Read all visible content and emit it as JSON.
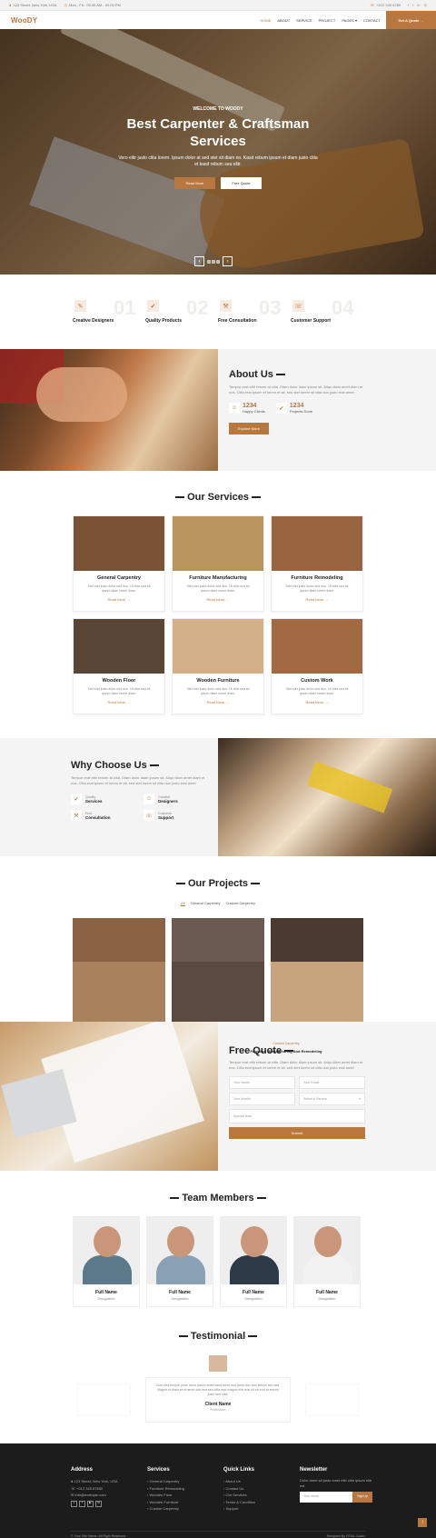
{
  "topbar": {
    "address": "123 Street, New York, USA",
    "hours": "Mon - Fri : 09.00 AM - 09.00 PM",
    "phone": "+012 345 6789"
  },
  "nav": {
    "logo": "WooDY",
    "items": [
      "HOME",
      "ABOUT",
      "SERVICE",
      "PROJECT",
      "PAGES",
      "CONTACT"
    ],
    "quote": "Get A Quote"
  },
  "hero": {
    "subtitle": "WELCOME TO WOODY",
    "title": "Best Carpenter & Craftsman Services",
    "desc": "Vero elitr justo clita lorem. Ipsum dolor at sed stet sit diam no. Kasd rebum ipsum et diam justo clita et kasd rebum sea elitr.",
    "btn1": "Read More",
    "btn2": "Free Quote",
    "prev": "‹",
    "next": "›"
  },
  "features": [
    {
      "num": "01",
      "label": "Creative Designers",
      "icon": "✎"
    },
    {
      "num": "02",
      "label": "Quality Products",
      "icon": "✔"
    },
    {
      "num": "03",
      "label": "Free Consultation",
      "icon": "⚒"
    },
    {
      "num": "04",
      "label": "Customer Support",
      "icon": "☏"
    }
  ],
  "about": {
    "title": "About Us",
    "desc": "Tempor erat elitr rebum at clita. Diam dolor diam ipsum sit. Aliqu diam amet diam et eos. Clita erat ipsum et lorem et sit, sed stet lorem sit clita duo justo erat amet",
    "stats": [
      {
        "num": "1234",
        "label": "Happy Clients",
        "icon": "☺"
      },
      {
        "num": "1234",
        "label": "Projects Done",
        "icon": "✔"
      }
    ],
    "btn": "Explore More"
  },
  "services": {
    "title": "Our Services",
    "desc": "Stet stet justo dolor sed duo. Ut clita sea sit ipsum diam lorem diam.",
    "link": "Read More →",
    "items": [
      {
        "title": "General Carpentry",
        "img": "#7a5236"
      },
      {
        "title": "Furniture Manufacturing",
        "img": "#b8945e"
      },
      {
        "title": "Furniture Remodeling",
        "img": "#9a6440"
      },
      {
        "title": "Wooden Floor",
        "img": "#5a4636"
      },
      {
        "title": "Wooden Furniture",
        "img": "#d4b08a"
      },
      {
        "title": "Custom Work",
        "img": "#a26a42"
      }
    ]
  },
  "why": {
    "title": "Why Choose Us",
    "desc": "Tempor erat elitr rebum at clita. Diam dolor diam ipsum sit. Aliqu diam amet diam et eos. Clita erat ipsum et lorem et sit, sed stet lorem sit clita duo justo erat amet",
    "items": [
      {
        "small": "Quality",
        "big": "Services",
        "icon": "✔"
      },
      {
        "small": "Creative",
        "big": "Designers",
        "icon": "☺"
      },
      {
        "small": "Free",
        "big": "Consultation",
        "icon": "⚒"
      },
      {
        "small": "Customer",
        "big": "Support",
        "icon": "☏"
      }
    ]
  },
  "projects": {
    "title": "Our Projects",
    "filters": [
      "All",
      "General Carpentry",
      "Custom Carpentry"
    ],
    "overlay_cat": "Custom Carpentry",
    "overlay_title": "Furniture Manufacturing And Remodeling",
    "images": [
      "#8a6442",
      "#6a5a50",
      "#a8825c",
      "#b89470",
      "#4a3a30",
      "#c8a47c"
    ]
  },
  "quote": {
    "title": "Free Quote",
    "desc": "Tempor erat elitr rebum at clita. Diam dolor diam ipsum sit. Aliqu diam amet diam et eos. Clita erat ipsum et lorem et sit, sed stet lorem sit clita duo justo erat amet",
    "name": "Your Name",
    "email": "Your Email",
    "mobile": "Your Mobile",
    "service": "Select A Service",
    "note": "Special Note",
    "submit": "Submit"
  },
  "team": {
    "title": "Team Members",
    "members": [
      {
        "name": "Full Name",
        "role": "Designation",
        "shirt": "#5a7a8a"
      },
      {
        "name": "Full Name",
        "role": "Designation",
        "shirt": "#8aa0b4"
      },
      {
        "name": "Full Name",
        "role": "Designation",
        "shirt": "#2e3a48"
      },
      {
        "name": "Full Name",
        "role": "Designation",
        "shirt": "#f2f2f2"
      }
    ]
  },
  "testimonial": {
    "title": "Testimonial",
    "text": "Clita clita tempor justo dolor ipsum amet kasd amet duo justo duo duo labore sed sed. Magna ut diam sit et amet stet eos sed clita erat magna elitr erat sit sit erat at rebum justo sea clita.",
    "name": "Client Name",
    "role": "Profession"
  },
  "footer": {
    "address": {
      "title": "Address",
      "lines": [
        "123 Street, New York, USA",
        "+012 345 67890",
        "info@example.com"
      ]
    },
    "services": {
      "title": "Services",
      "links": [
        "General Carpentry",
        "Furniture Remodeling",
        "Wooden Floor",
        "Wooden Furniture",
        "Custom Carpentry"
      ]
    },
    "quick": {
      "title": "Quick Links",
      "links": [
        "About Us",
        "Contact Us",
        "Our Services",
        "Terms & Condition",
        "Support"
      ]
    },
    "newsletter": {
      "title": "Newsletter",
      "desc": "Dolor amet sit justo amet elitr clita ipsum elitr est.",
      "placeholder": "Your email",
      "btn": "SignUp"
    },
    "copyright": "© Your Site Name, All Right Reserved.",
    "designed": "Designed By HTML Codex"
  },
  "colors": {
    "accent": "#b8773f",
    "dark": "#1c1c1c"
  }
}
